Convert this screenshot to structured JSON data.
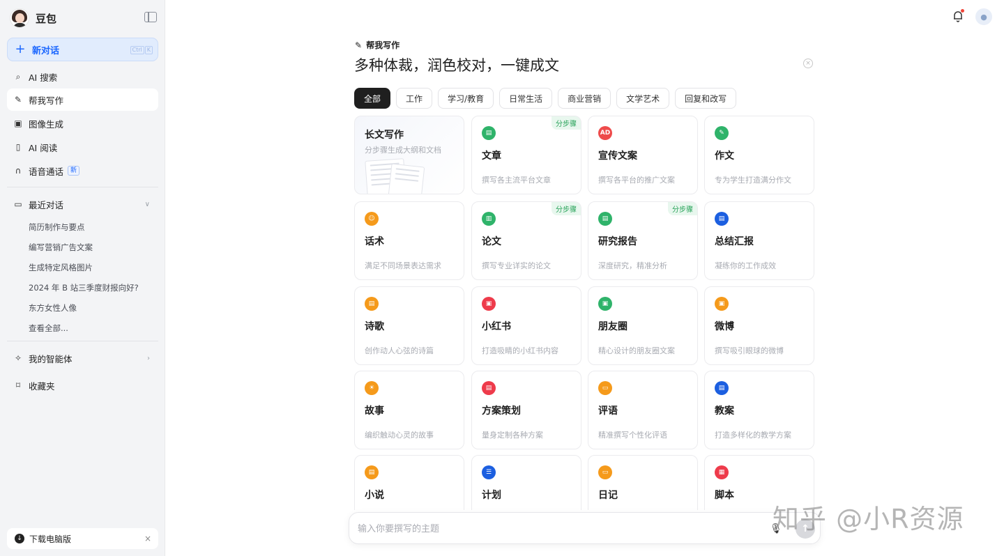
{
  "sidebar": {
    "brand": "豆包",
    "new_chat": {
      "label": "新对话",
      "shortcut": [
        "Ctrl",
        "K"
      ]
    },
    "nav": [
      {
        "label": "AI 搜索",
        "icon": "search-icon"
      },
      {
        "label": "帮我写作",
        "icon": "pen-icon",
        "active": true
      },
      {
        "label": "图像生成",
        "icon": "image-icon"
      },
      {
        "label": "AI 阅读",
        "icon": "book-icon"
      },
      {
        "label": "语音通话",
        "icon": "headphones-icon",
        "badge": "新"
      }
    ],
    "recent": {
      "title": "最近对话",
      "items": [
        "简历制作与要点",
        "编写营销广告文案",
        "生成特定风格图片",
        "2024 年 B 站三季度财报向好?",
        "东方女性人像",
        "查看全部..."
      ]
    },
    "agents": "我的智能体",
    "favorites": "收藏夹",
    "download": "下载电脑版"
  },
  "main": {
    "section_title": "帮我写作",
    "headline": "多种体裁，润色校对，一键成文",
    "tabs": [
      "全部",
      "工作",
      "学习/教育",
      "日常生活",
      "商业营销",
      "文学艺术",
      "回复和改写"
    ],
    "cards": [
      {
        "title": "长文写作",
        "desc": "分步骤生成大纲和文档"
      },
      {
        "title": "文章",
        "desc": "撰写各主流平台文章",
        "color": "#2fb36a",
        "glyph": "▤",
        "step": "分步骤"
      },
      {
        "title": "宣传文案",
        "desc": "撰写各平台的推广文案",
        "color": "#ee4b4b",
        "glyph": "AD"
      },
      {
        "title": "作文",
        "desc": "专为学生打造满分作文",
        "color": "#2fb36a",
        "glyph": "✎"
      },
      {
        "title": "话术",
        "desc": "满足不同场景表达需求",
        "color": "#f59a1b",
        "glyph": "☺"
      },
      {
        "title": "论文",
        "desc": "撰写专业详实的论文",
        "color": "#2fb36a",
        "glyph": "▥",
        "step": "分步骤"
      },
      {
        "title": "研究报告",
        "desc": "深度研究，精准分析",
        "color": "#2fb36a",
        "glyph": "▤",
        "step": "分步骤"
      },
      {
        "title": "总结汇报",
        "desc": "凝练你的工作成效",
        "color": "#1c5fe0",
        "glyph": "▤"
      },
      {
        "title": "诗歌",
        "desc": "创作动人心弦的诗篇",
        "color": "#f59a1b",
        "glyph": "▤"
      },
      {
        "title": "小红书",
        "desc": "打造吸睛的小红书内容",
        "color": "#ee3b4b",
        "glyph": "▣"
      },
      {
        "title": "朋友圈",
        "desc": "精心设计的朋友圈文案",
        "color": "#2fb36a",
        "glyph": "▣"
      },
      {
        "title": "微博",
        "desc": "撰写吸引眼球的微博",
        "color": "#f59a1b",
        "glyph": "▣"
      },
      {
        "title": "故事",
        "desc": "编织触动心灵的故事",
        "color": "#f59a1b",
        "glyph": "☀"
      },
      {
        "title": "方案策划",
        "desc": "量身定制各种方案",
        "color": "#ee3b4b",
        "glyph": "▤"
      },
      {
        "title": "评语",
        "desc": "精准撰写个性化评语",
        "color": "#f59a1b",
        "glyph": "▭"
      },
      {
        "title": "教案",
        "desc": "打造多样化的教学方案",
        "color": "#1c5fe0",
        "glyph": "▤"
      },
      {
        "title": "小说",
        "desc": "",
        "color": "#f59a1b",
        "glyph": "▤"
      },
      {
        "title": "计划",
        "desc": "",
        "color": "#1c5fe0",
        "glyph": "☰"
      },
      {
        "title": "日记",
        "desc": "",
        "color": "#f59a1b",
        "glyph": "▭"
      },
      {
        "title": "脚本",
        "desc": "",
        "color": "#ee3b4b",
        "glyph": "▦"
      }
    ],
    "input_placeholder": "输入你要撰写的主题"
  },
  "watermark": "知乎 @小R资源"
}
